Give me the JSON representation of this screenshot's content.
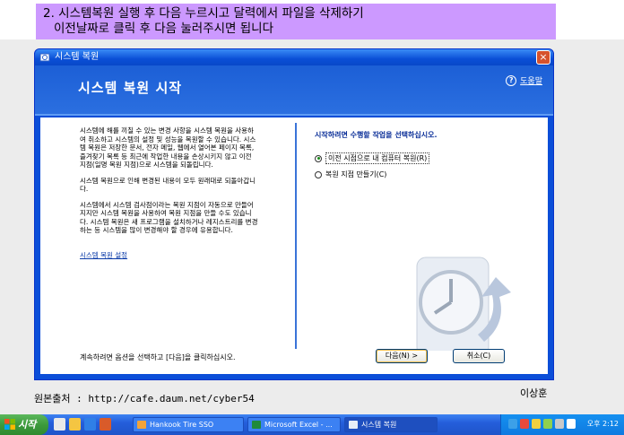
{
  "banner": {
    "line1": "2. 시스템복원 실행 후 다음 누르시고 달력에서 파일을 삭제하기",
    "line2": "이전날짜로 클릭 후 다음 눌러주시면 됩니다"
  },
  "window": {
    "title": "시스템 복원",
    "header_title": "시스템 복원 시작",
    "help_label": "도움말",
    "close_label": "×"
  },
  "left": {
    "para1": "시스템에 해를 끼칠 수 있는 변경 사항을 시스템 복원을 사용하여 취소하고 시스템의 설정 및 성능을 복원할 수 있습니다. 시스템 복원은 저장한 문서, 전자 메일, 웹에서 열어본 페이지 목록, 즐겨찾기 목록 등 최근에 작업한 내용을 손상시키지 않고 이전 지점(일명 복원 지점)으로 시스템을 되돌립니다.",
    "para2": "시스템 복원으로 인해 변경된 내용이 모두 원래대로 되돌아갑니다.",
    "para3": "시스템에서 시스템 검사점이라는 복원 지점이 자동으로 만들어지지만 시스템 복원을 사용하여 복원 지점을 만들 수도 있습니다. 시스템 복원은 새 프로그램을 설치하거나 레지스트리를 변경하는 등 시스템을 많이 변경해야 할 경우에 유용합니다.",
    "settings_link": "시스템 복원 설정",
    "bottom_note": "계속하려면 옵션을 선택하고 [다음]을 클릭하십시오."
  },
  "right": {
    "question": "시작하려면 수행할 작업을 선택하십시오.",
    "options": [
      {
        "label": "이전 시점으로 내 컴퓨터 복원(R)",
        "selected": true
      },
      {
        "label": "복원 지점 만들기(C)",
        "selected": false
      }
    ]
  },
  "buttons": {
    "next": "다음(N) >",
    "cancel": "취소(C)"
  },
  "footer": {
    "source": "원본출처 : http://cafe.daum.net/cyber54",
    "author": "이상훈"
  },
  "taskbar": {
    "start_label": "시작",
    "tasks": [
      {
        "label": "Hankook Tire SSO",
        "icon": "ie-icon"
      },
      {
        "label": "Microsoft Excel - ...",
        "icon": "excel-icon"
      },
      {
        "label": "시스템 복원",
        "icon": "system-restore-icon"
      }
    ],
    "clock": "오후 2:12"
  },
  "colors": {
    "banner": "#cc99ff",
    "xp_blue": "#0b4ed8",
    "start_green": "#3c9a3c"
  }
}
